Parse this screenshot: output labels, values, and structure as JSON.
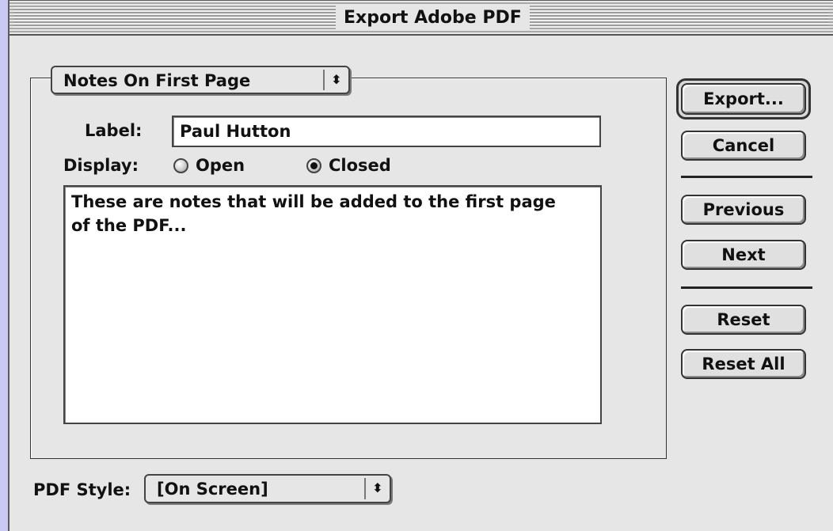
{
  "window": {
    "title": "Export Adobe PDF"
  },
  "section_popup": {
    "selected": "Notes On First Page",
    "arrow_glyph": "⬍"
  },
  "form": {
    "label_caption": "Label:",
    "label_value": "Paul Hutton",
    "display_caption": "Display:",
    "display_options": [
      {
        "label": "Open",
        "selected": false
      },
      {
        "label": "Closed",
        "selected": true
      }
    ],
    "notes_text": "These are notes that will be added to the first page\nof the PDF..."
  },
  "buttons": {
    "export": "Export...",
    "cancel": "Cancel",
    "previous": "Previous",
    "next": "Next",
    "reset": "Reset",
    "reset_all": "Reset All"
  },
  "pdf_style": {
    "caption": "PDF Style:",
    "selected": "[On Screen]",
    "arrow_glyph": "⬍"
  },
  "colors": {
    "desktop": "#c9c9f3",
    "window_bg": "#e6e6e6"
  }
}
